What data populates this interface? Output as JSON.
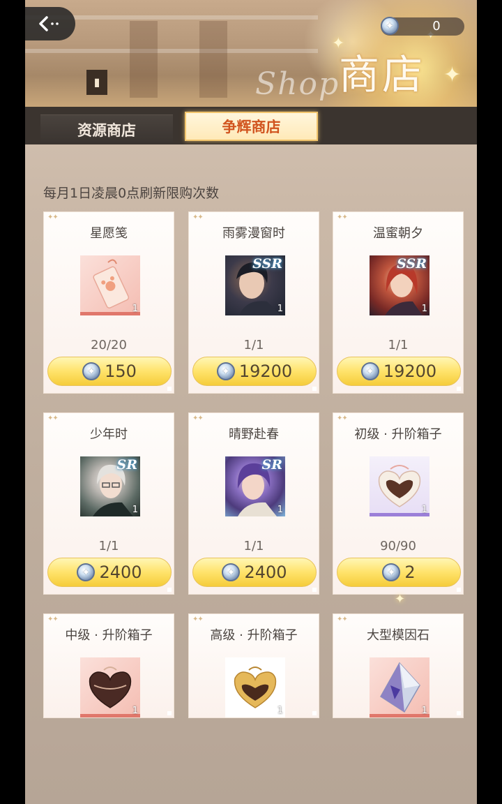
{
  "header": {
    "back_label": "<··",
    "currency_value": "0",
    "title": "商店",
    "script_text": "Shop"
  },
  "tabs": [
    {
      "label": "资源商店",
      "active": false
    },
    {
      "label": "争辉商店",
      "active": true
    }
  ],
  "notice": "每月1日凌晨0点刷新限购次数",
  "colors": {
    "active_tab_text": "#d1541f",
    "buy_button": "#ffe36b",
    "tabbar": "#3b342f"
  },
  "items": [
    {
      "name": "星愿笺",
      "qty": "1",
      "rarity": "",
      "limit": "20/20",
      "price": "150",
      "art": "pink-envelope"
    },
    {
      "name": "雨雾漫窗时",
      "qty": "1",
      "rarity": "SSR",
      "limit": "1/1",
      "price": "19200",
      "art": "dark-hair-portrait"
    },
    {
      "name": "温蜜朝夕",
      "qty": "1",
      "rarity": "SSR",
      "limit": "1/1",
      "price": "19200",
      "art": "red-hair-portrait"
    },
    {
      "name": "少年时",
      "qty": "1",
      "rarity": "SR",
      "limit": "1/1",
      "price": "2400",
      "art": "silver-hair-portrait"
    },
    {
      "name": "晴野赴春",
      "qty": "1",
      "rarity": "SR",
      "limit": "1/1",
      "price": "2400",
      "art": "purple-hair-portrait"
    },
    {
      "name": "初级 · 升阶箱子",
      "qty": "1",
      "rarity": "",
      "limit": "90/90",
      "price": "2",
      "art": "heart-box-pink"
    },
    {
      "name": "中级 · 升阶箱子",
      "qty": "1",
      "rarity": "",
      "limit": "",
      "price": "",
      "art": "heart-box-brown"
    },
    {
      "name": "高级 · 升阶箱子",
      "qty": "1",
      "rarity": "",
      "limit": "",
      "price": "",
      "art": "heart-box-gold"
    },
    {
      "name": "大型模因石",
      "qty": "1",
      "rarity": "",
      "limit": "",
      "price": "",
      "art": "crystal"
    }
  ]
}
